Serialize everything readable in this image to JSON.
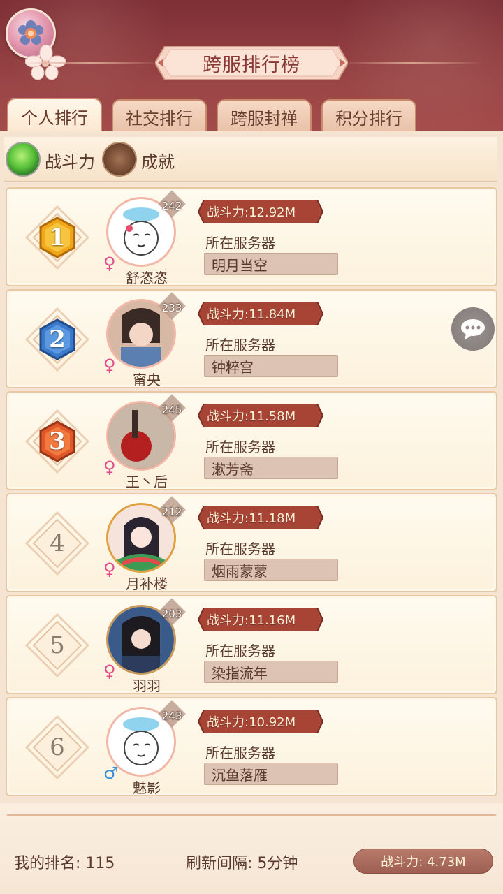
{
  "header": {
    "title": "跨服排行榜"
  },
  "tabs": [
    {
      "label": "个人排行",
      "active": true
    },
    {
      "label": "社交排行",
      "active": false
    },
    {
      "label": "跨服封禅",
      "active": false
    },
    {
      "label": "积分排行",
      "active": false
    }
  ],
  "filters": {
    "power_label": "战斗力",
    "achievement_label": "成就",
    "selected": "战斗力"
  },
  "rows": [
    {
      "rank": "1",
      "level": "242",
      "name": "舒恣恣",
      "gender": "female",
      "power": "战斗力:12.92M",
      "server_label": "所在服务器",
      "server": "明月当空"
    },
    {
      "rank": "2",
      "level": "233",
      "name": "甯央",
      "gender": "female",
      "power": "战斗力:11.84M",
      "server_label": "所在服务器",
      "server": "钟粹宫"
    },
    {
      "rank": "3",
      "level": "245",
      "name": "王丶后",
      "gender": "female",
      "power": "战斗力:11.58M",
      "server_label": "所在服务器",
      "server": "漱芳斋"
    },
    {
      "rank": "4",
      "level": "212",
      "name": "月补楼",
      "gender": "female",
      "power": "战斗力:11.18M",
      "server_label": "所在服务器",
      "server": "烟雨蒙蒙"
    },
    {
      "rank": "5",
      "level": "203",
      "name": "羽羽",
      "gender": "female",
      "power": "战斗力:11.16M",
      "server_label": "所在服务器",
      "server": "染指流年"
    },
    {
      "rank": "6",
      "level": "243",
      "name": "魅影",
      "gender": "male",
      "power": "战斗力:10.92M",
      "server_label": "所在服务器",
      "server": "沉鱼落雁"
    }
  ],
  "footer": {
    "my_rank": "我的排名:  115",
    "refresh": "刷新间隔:  5分钟",
    "my_power": "战斗力:  4.73M"
  },
  "icons": {
    "settings": "settings-flower-icon",
    "chat": "chat-bubble-icon",
    "female": "♀",
    "male": "♂"
  },
  "colors": {
    "header_bg": "#8e3b3f",
    "panel_bg": "#f4e4d1",
    "accent_red": "#a3473c",
    "text": "#5a3a2c"
  }
}
